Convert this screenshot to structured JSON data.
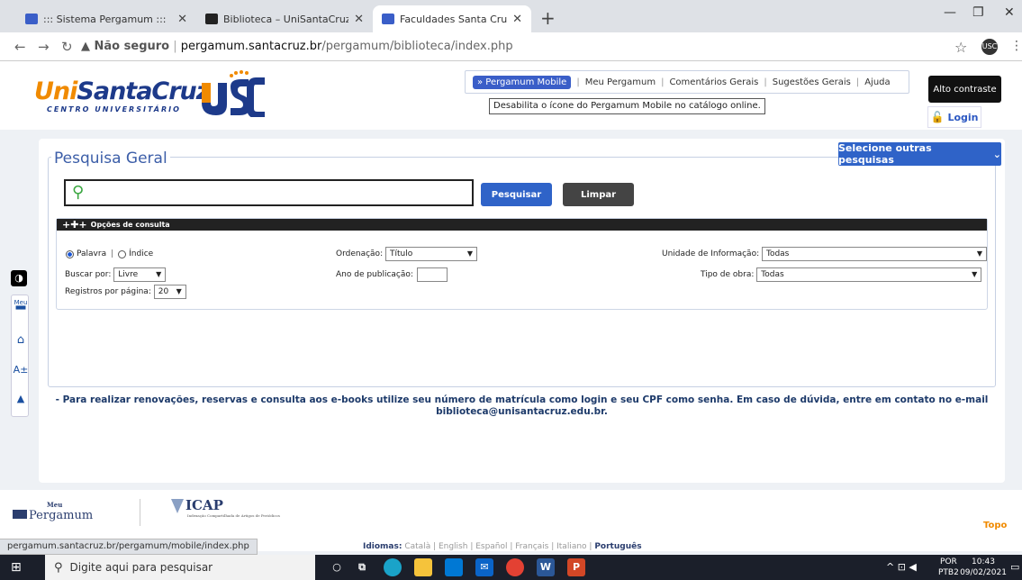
{
  "browser": {
    "tabs": [
      {
        "title": "::: Sistema Pergamum :::",
        "active": false
      },
      {
        "title": "Biblioteca – UniSantaCruz",
        "active": false
      },
      {
        "title": "Faculdades Santa Cruz",
        "active": true
      }
    ],
    "new_tab": "+",
    "security_label": "▲ Não seguro",
    "url_host": "pergamum.santacruz.br",
    "url_path": "/pergamum/biblioteca/index.php",
    "status_url": "pergamum.santacruz.br/pergamum/mobile/index.php"
  },
  "header": {
    "logo_uni": "Uni",
    "logo_rest": "SantaCruz",
    "logo_sub": "CENTRO UNIVERSITÁRIO",
    "menu": {
      "mobile": "» Pergamum Mobile",
      "meu": "Meu Pergamum",
      "comentarios": "Comentários Gerais",
      "sugestoes": "Sugestões Gerais",
      "ajuda": "Ajuda",
      "separator": "|"
    },
    "tooltip": "Desabilita o ícone do Pergamum Mobile no catálogo online.",
    "contrast": "Alto contraste",
    "login": "Login"
  },
  "search": {
    "legend": "Pesquisa Geral",
    "other": "Selecione outras pesquisas",
    "query": "",
    "search_btn": "Pesquisar",
    "clear_btn": "Limpar"
  },
  "options": {
    "title": "Opções de consulta",
    "palavra": "Palavra",
    "indice": "Índice",
    "ordenacao_label": "Ordenação:",
    "ordenacao_value": "Título",
    "unidade_label": "Unidade de Informação:",
    "unidade_value": "Todas",
    "buscar_label": "Buscar por:",
    "buscar_value": "Livre",
    "ano_label": "Ano de publicação:",
    "tipo_label": "Tipo de obra:",
    "tipo_value": "Todas",
    "registros_label": "Registros por página:",
    "registros_value": "20"
  },
  "notice": {
    "line1": "- Para realizar renovações, reservas e consulta aos e-books utilize seu número de matrícula como login e seu CPF como senha. Em caso de dúvida, entre em contato no e-mail",
    "line2": "biblioteca@unisantacruz.edu.br."
  },
  "footer": {
    "meu": "Meu",
    "pergamum": "Pergamum",
    "icap": "ICAP",
    "icap_sub": "Indexação Compartilhada de Artigos de Periódicos",
    "topo": "Topo",
    "idiomas_label": "Idiomas:",
    "langs": "Català | English | Español | Français | Italiano |",
    "current_lang": "Português"
  },
  "taskbar": {
    "search_placeholder": "Digite aqui para pesquisar",
    "lang": "POR",
    "layout": "PTB2",
    "time": "10:43",
    "date": "09/02/2021"
  },
  "colors": {
    "brand_blue": "#2f63c8",
    "brand_orange": "#f08a00"
  }
}
